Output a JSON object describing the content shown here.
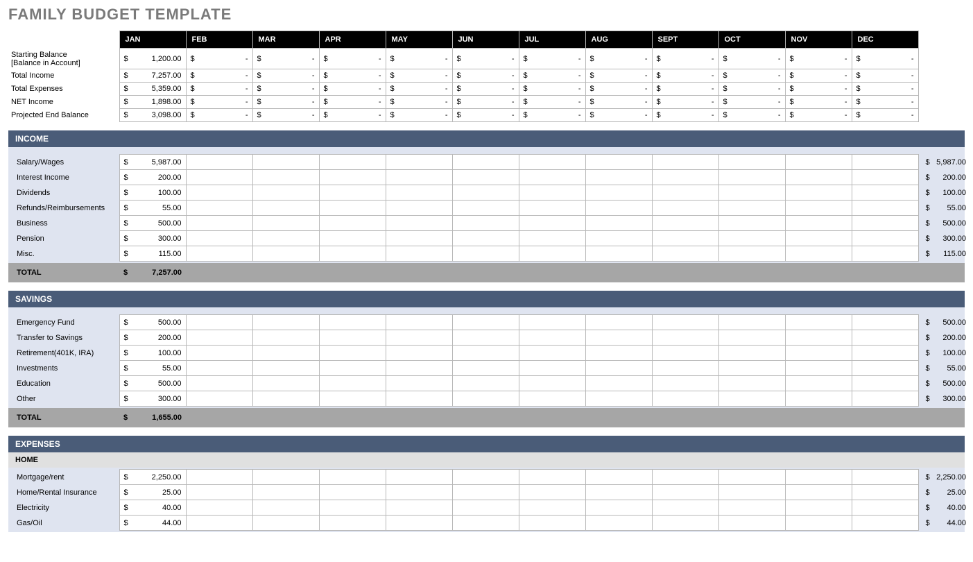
{
  "title": "FAMILY BUDGET TEMPLATE",
  "months": [
    "JAN",
    "FEB",
    "MAR",
    "APR",
    "MAY",
    "JUN",
    "JUL",
    "AUG",
    "SEPT",
    "OCT",
    "NOV",
    "DEC"
  ],
  "summary": {
    "rows": [
      {
        "label": "Starting Balance",
        "sub": "[Balance in Account]",
        "jan": "1,200.00"
      },
      {
        "label": "Total Income",
        "sub": "",
        "jan": "7,257.00"
      },
      {
        "label": "Total Expenses",
        "sub": "",
        "jan": "5,359.00"
      },
      {
        "label": "NET Income",
        "sub": "",
        "jan": "1,898.00"
      },
      {
        "label": "Projected End Balance",
        "sub": "",
        "jan": "3,098.00"
      }
    ]
  },
  "income": {
    "header": "INCOME",
    "rows": [
      {
        "label": "Salary/Wages",
        "jan": "5,987.00",
        "total": "5,987.00"
      },
      {
        "label": "Interest Income",
        "jan": "200.00",
        "total": "200.00"
      },
      {
        "label": "Dividends",
        "jan": "100.00",
        "total": "100.00"
      },
      {
        "label": "Refunds/Reimbursements",
        "jan": "55.00",
        "total": "55.00"
      },
      {
        "label": "Business",
        "jan": "500.00",
        "total": "500.00"
      },
      {
        "label": "Pension",
        "jan": "300.00",
        "total": "300.00"
      },
      {
        "label": "Misc.",
        "jan": "115.00",
        "total": "115.00"
      }
    ],
    "total_label": "TOTAL",
    "total_jan": "7,257.00"
  },
  "savings": {
    "header": "SAVINGS",
    "rows": [
      {
        "label": "Emergency Fund",
        "jan": "500.00",
        "total": "500.00"
      },
      {
        "label": "Transfer to Savings",
        "jan": "200.00",
        "total": "200.00"
      },
      {
        "label": "Retirement(401K, IRA)",
        "jan": "100.00",
        "total": "100.00"
      },
      {
        "label": "Investments",
        "jan": "55.00",
        "total": "55.00"
      },
      {
        "label": "Education",
        "jan": "500.00",
        "total": "500.00"
      },
      {
        "label": "Other",
        "jan": "300.00",
        "total": "300.00"
      }
    ],
    "total_label": "TOTAL",
    "total_jan": "1,655.00"
  },
  "expenses": {
    "header": "EXPENSES",
    "home": {
      "sub_header": "HOME",
      "rows": [
        {
          "label": "Mortgage/rent",
          "jan": "2,250.00",
          "total": "2,250.00"
        },
        {
          "label": "Home/Rental Insurance",
          "jan": "25.00",
          "total": "25.00"
        },
        {
          "label": "Electricity",
          "jan": "40.00",
          "total": "40.00"
        },
        {
          "label": "Gas/Oil",
          "jan": "44.00",
          "total": "44.00"
        }
      ]
    }
  }
}
